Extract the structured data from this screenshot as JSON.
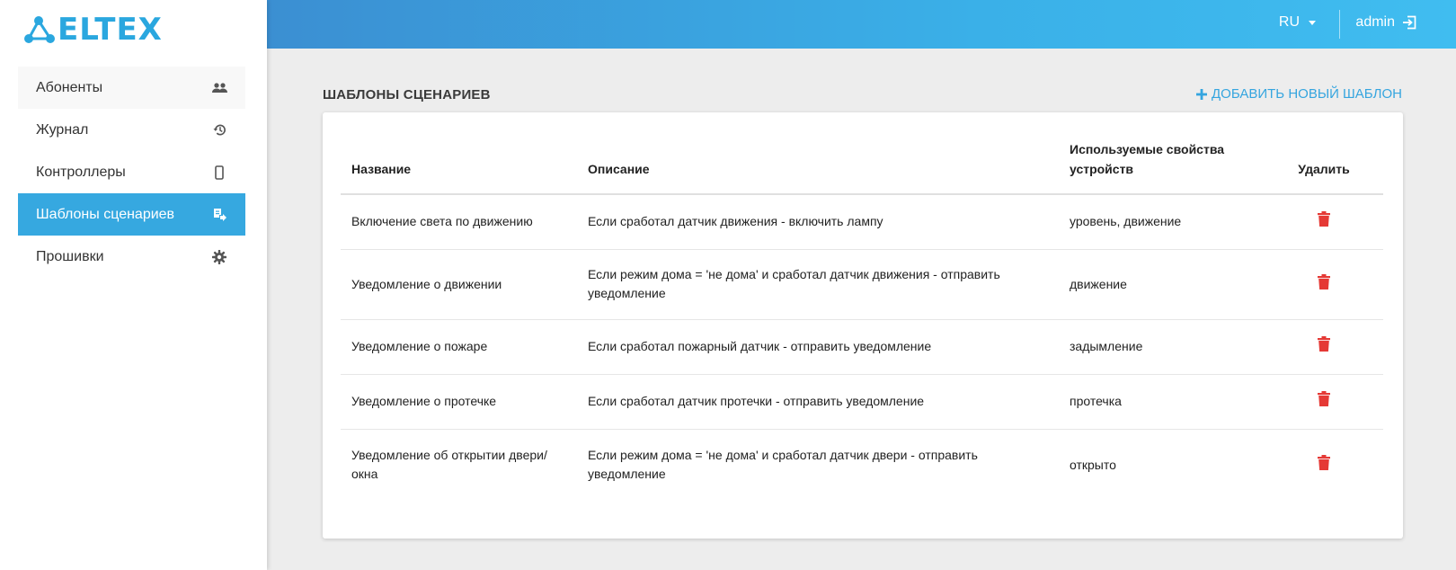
{
  "brand": {
    "logo_text": "ELTEX",
    "accent": "#36a8e0",
    "delete_color": "#e53935"
  },
  "header": {
    "lang": "RU",
    "user": "admin"
  },
  "sidebar": {
    "items": [
      {
        "label": "Абоненты",
        "icon": "users-icon"
      },
      {
        "label": "Журнал",
        "icon": "history-icon"
      },
      {
        "label": "Контроллеры",
        "icon": "device-icon"
      },
      {
        "label": "Шаблоны сценариев",
        "icon": "template-icon",
        "active": true
      },
      {
        "label": "Прошивки",
        "icon": "gear-icon"
      }
    ]
  },
  "page": {
    "title": "ШАБЛОНЫ СЦЕНАРИЕВ",
    "add_label": "ДОБАВИТЬ НОВЫЙ ШАБЛОН"
  },
  "table": {
    "headers": {
      "name": "Название",
      "description": "Описание",
      "properties": "Используемые свойства устройств",
      "delete": "Удалить"
    },
    "rows": [
      {
        "name": "Включение света по движению",
        "description": "Если сработал датчик движения - включить лампу",
        "properties": "уровень, движение"
      },
      {
        "name": "Уведомление о движении",
        "description": "Если режим дома = 'не дома' и сработал датчик движения - отправить уведомление",
        "properties": "движение"
      },
      {
        "name": "Уведомление о пожаре",
        "description": "Если сработал пожарный датчик - отправить уведомление",
        "properties": "задымление"
      },
      {
        "name": "Уведомление о протечке",
        "description": "Если сработал датчик протечки - отправить уведомление",
        "properties": "протечка"
      },
      {
        "name": "Уведомление об открытии двери/окна",
        "description": "Если режим дома = 'не дома' и сработал датчик двери - отправить уведомление",
        "properties": "открыто"
      }
    ]
  }
}
